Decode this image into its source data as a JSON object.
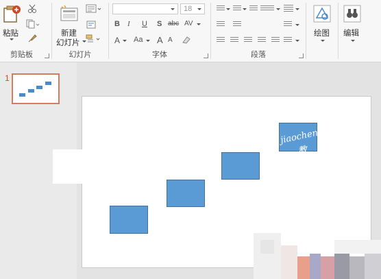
{
  "clipboard": {
    "paste_label": "粘贴",
    "group_label": "剪贴板"
  },
  "slides_group": {
    "new_slide_label_line1": "新建",
    "new_slide_label_line2": "幻灯片",
    "group_label": "幻灯片"
  },
  "font_group": {
    "font_name_value": "",
    "font_size_value": "18",
    "bold": "B",
    "italic": "I",
    "underline": "U",
    "shadow": "S",
    "strikethrough": "abc",
    "spacing": "AV",
    "font_color": "A",
    "change_case": "Aa",
    "grow": "A",
    "shrink": "A",
    "group_label": "字体"
  },
  "paragraph_group": {
    "group_label": "段落"
  },
  "drawing": {
    "label": "绘图"
  },
  "editing": {
    "label": "编辑"
  },
  "thumbnails": {
    "slide_number": "1"
  },
  "watermark": {
    "text_line1": "jiaochen",
    "text_line2": "教"
  },
  "colors": {
    "accent": "#d24726",
    "shape_fill": "#5b9bd5",
    "shape_border": "#41719c"
  },
  "icons": {
    "paste": "clipboard-icon",
    "cut": "scissors-icon",
    "copy": "copy-icon",
    "format_painter": "brush-icon",
    "new_slide": "new-slide-icon",
    "drawing": "shapes-icon",
    "editing": "binoculars-icon"
  }
}
